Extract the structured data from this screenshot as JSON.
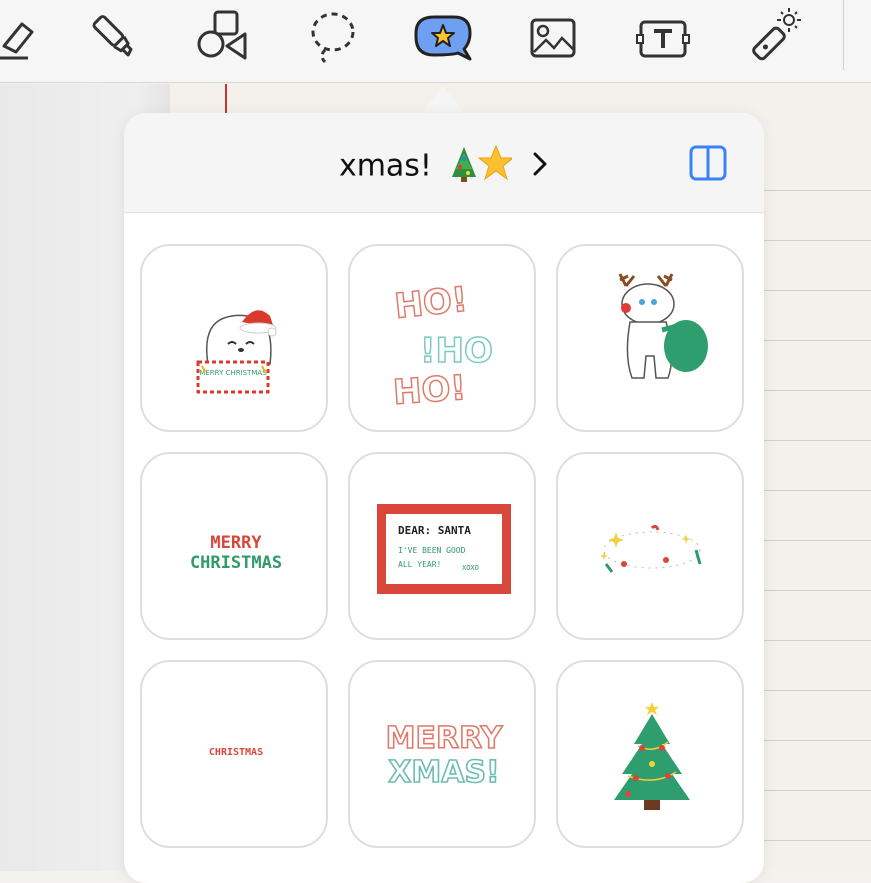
{
  "toolbar": {
    "tools": [
      {
        "name": "eraser-tool",
        "icon": "eraser-icon"
      },
      {
        "name": "highlighter-tool",
        "icon": "highlighter-icon"
      },
      {
        "name": "shapes-tool",
        "icon": "shapes-icon"
      },
      {
        "name": "lasso-tool",
        "icon": "lasso-icon"
      },
      {
        "name": "sticker-tool",
        "icon": "star-sticker-icon",
        "selected": true
      },
      {
        "name": "image-tool",
        "icon": "image-icon"
      },
      {
        "name": "text-tool",
        "icon": "text-box-icon"
      },
      {
        "name": "laser-pointer-tool",
        "icon": "laser-pointer-icon"
      }
    ],
    "accent_color": "#3b82f6"
  },
  "popover": {
    "title": "xmas!",
    "title_emoji": "🎄⭐",
    "split_view_icon": "split-view-icon"
  },
  "stickers": [
    {
      "name": "bear-merry-christmas",
      "text": "MERRY CHRISTMAS"
    },
    {
      "name": "ho-ho-ho",
      "text": "HO! !HO HO!"
    },
    {
      "name": "reindeer-moomin",
      "text": ""
    },
    {
      "name": "merry-christmas-lettering",
      "text_line1": "MERRY",
      "text_line2": "CHRISTMAS"
    },
    {
      "name": "dear-santa-stamp",
      "line1": "DEAR: SANTA",
      "line2": "I'VE BEEN GOOD",
      "line3": "ALL YEAR!",
      "signoff": "XOXO"
    },
    {
      "name": "sparkle-garland",
      "text": ""
    },
    {
      "name": "christmas-small-text",
      "text": "CHRISTMAS"
    },
    {
      "name": "merry-xmas-outline",
      "text_line1": "MERRY",
      "text_line2": "XMAS!"
    },
    {
      "name": "christmas-tree",
      "text": ""
    }
  ]
}
